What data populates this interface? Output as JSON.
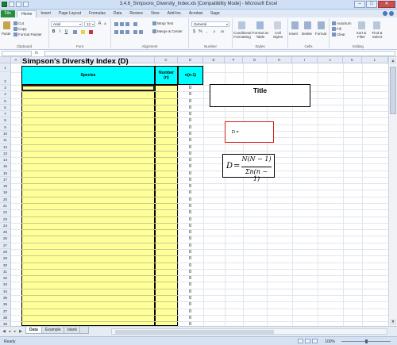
{
  "window": {
    "title": "3.4.6_Simpsons_Diversity_Index.xls  [Compatibility Mode]  -  Microsoft Excel",
    "controls": [
      "–",
      "□",
      "✕"
    ]
  },
  "ribbon_tabs": [
    "File",
    "Home",
    "Insert",
    "Page Layout",
    "Formulas",
    "Data",
    "Review",
    "View",
    "Add-Ins",
    "Acrobat",
    "Sage"
  ],
  "active_ribbon_tab": "Home",
  "ribbon": {
    "clipboard": {
      "paste": "Paste",
      "cut": "Cut",
      "copy": "Copy",
      "format_painter": "Format Painter",
      "label": "Clipboard"
    },
    "font": {
      "name": "Arial",
      "size": "12",
      "label": "Font",
      "bold": "B",
      "italic": "I",
      "underline": "U",
      "grow": "A",
      "shrink": "A"
    },
    "alignment": {
      "wrap": "Wrap Text",
      "merge": "Merge & Center",
      "label": "Alignment"
    },
    "number": {
      "format": "General",
      "label": "Number",
      "currency": "$",
      "percent": "%",
      "comma": ",",
      "dec_inc": ".0",
      "dec_dec": ".00"
    },
    "styles": {
      "conditional": "Conditional Formatting",
      "format_table": "Format as Table",
      "cell_styles": "Cell Styles",
      "label": "Styles"
    },
    "cells": {
      "insert": "Insert",
      "delete": "Delete",
      "format": "Format",
      "label": "Cells"
    },
    "editing": {
      "autosum": "AutoSum",
      "fill": "Fill",
      "clear": "Clear",
      "sort": "Sort & Filter",
      "find": "Find & Select",
      "label": "Editing"
    }
  },
  "formula_bar": {
    "name_box": "",
    "fx": "fx",
    "formula": ""
  },
  "columns": [
    "A",
    "B",
    "C",
    "D",
    "E",
    "F",
    "G",
    "H",
    "I",
    "J",
    "K",
    "L"
  ],
  "rows": [
    "1",
    "2",
    "3",
    "4",
    "5",
    "6",
    "7",
    "8",
    "9",
    "10",
    "11",
    "12",
    "13",
    "14",
    "15",
    "16",
    "17",
    "18",
    "19",
    "20",
    "21",
    "22",
    "23",
    "24",
    "25",
    "26",
    "27",
    "28",
    "29",
    "30",
    "31",
    "32",
    "33",
    "34",
    "35",
    "36",
    "37",
    "38",
    "39"
  ],
  "sheet": {
    "title": "Simpson's Diversity Index (D)",
    "headers": {
      "species": "Species",
      "number": "Number\n(n)",
      "nn1": "n(n-1)"
    },
    "nn1_values": [
      "0",
      "0",
      "0",
      "0",
      "0",
      "0",
      "0",
      "0",
      "0",
      "0",
      "0",
      "0",
      "0",
      "0",
      "0",
      "0",
      "0",
      "0",
      "0",
      "0",
      "0",
      "0",
      "0",
      "0",
      "0",
      "0",
      "0",
      "0",
      "0",
      "0",
      "0",
      "0",
      "0",
      "0",
      "0",
      "0",
      "0"
    ],
    "title_box": "Title",
    "d_box": "D =",
    "equation": {
      "lhs": "D",
      "eq": "=",
      "numerator": "N(N − 1)",
      "denominator": "Σn(n − 1)"
    }
  },
  "sheet_tabs": [
    "Data",
    "Example",
    "blank"
  ],
  "active_sheet_tab": "Data",
  "status": {
    "ready": "Ready",
    "zoom": "100%"
  },
  "colors": {
    "header_cyan": "#00ffff",
    "input_yellow": "#ffff99",
    "d_box_border": "#d4201c",
    "file_tab": "#2a8c3e"
  }
}
